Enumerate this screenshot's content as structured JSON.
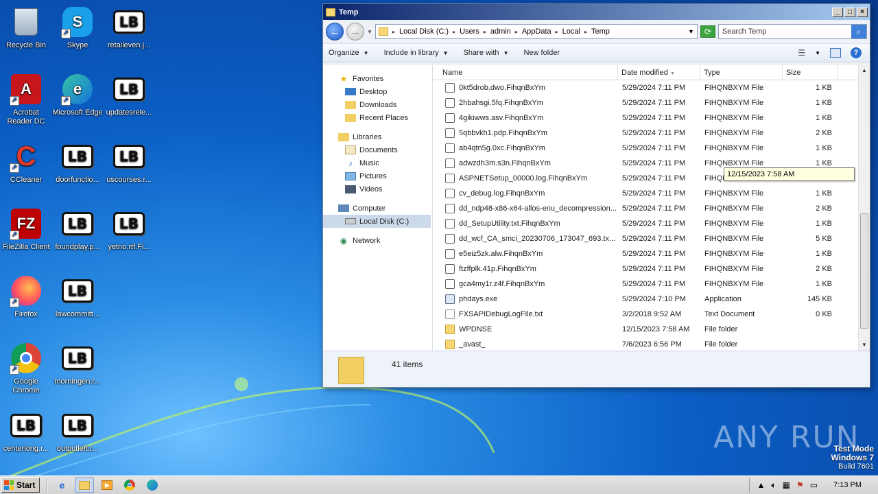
{
  "desktop": {
    "icons": [
      {
        "label": "Recycle Bin",
        "kind": "recycle-bin-icon",
        "shortcut": false
      },
      {
        "label": "Skype",
        "kind": "skype-icon",
        "shortcut": true
      },
      {
        "label": "retaileven.j...",
        "kind": "lb-file-icon",
        "shortcut": false
      },
      {
        "label": "Acrobat Reader DC",
        "kind": "acrobat-icon",
        "shortcut": true
      },
      {
        "label": "Microsoft Edge",
        "kind": "edge-icon",
        "shortcut": true
      },
      {
        "label": "updatesrele...",
        "kind": "lb-file-icon",
        "shortcut": false
      },
      {
        "label": "CCleaner",
        "kind": "ccleaner-icon",
        "shortcut": true
      },
      {
        "label": "doorfunctio...",
        "kind": "lb-file-icon",
        "shortcut": false
      },
      {
        "label": "uscourses.r...",
        "kind": "lb-file-icon",
        "shortcut": false
      },
      {
        "label": "FileZilla Client",
        "kind": "filezilla-icon",
        "shortcut": true
      },
      {
        "label": "foundplay.p...",
        "kind": "lb-file-icon",
        "shortcut": false
      },
      {
        "label": "yetno.rtf.Fi...",
        "kind": "lb-file-icon",
        "shortcut": false
      },
      {
        "label": "Firefox",
        "kind": "firefox-icon",
        "shortcut": true
      },
      {
        "label": "lawcommitt...",
        "kind": "lb-file-icon",
        "shortcut": false
      },
      {
        "label": "Google Chrome",
        "kind": "chrome-icon",
        "shortcut": true
      },
      {
        "label": "morningen.r...",
        "kind": "lb-file-icon",
        "shortcut": false
      },
      {
        "label": "centerlong.r...",
        "kind": "lb-file-icon",
        "shortcut": false
      },
      {
        "label": "outputleft.r...",
        "kind": "lb-file-icon",
        "shortcut": false
      }
    ]
  },
  "window": {
    "title": "Temp",
    "address": {
      "crumbs": [
        "Local Disk (C:)",
        "Users",
        "admin",
        "AppData",
        "Local",
        "Temp"
      ]
    },
    "search": {
      "placeholder": "Search Temp"
    },
    "toolbar": {
      "organize": "Organize",
      "include_in_library": "Include in library",
      "share_with": "Share with",
      "new_folder": "New folder"
    },
    "nav": {
      "favorites": "Favorites",
      "desktop": "Desktop",
      "downloads": "Downloads",
      "recent_places": "Recent Places",
      "libraries": "Libraries",
      "documents": "Documents",
      "music": "Music",
      "pictures": "Pictures",
      "videos": "Videos",
      "computer": "Computer",
      "local_disk": "Local Disk (C:)",
      "network": "Network"
    },
    "columns": {
      "name": "Name",
      "date": "Date modified",
      "type": "Type",
      "size": "Size"
    },
    "files": [
      {
        "name": "0kt5drob.dwo.FihqnBxYm",
        "date": "5/29/2024 7:11 PM",
        "type": "FIHQNBXYM File",
        "size": "1 KB",
        "icon": "generic"
      },
      {
        "name": "2hbahsgi.5fq.FihqnBxYm",
        "date": "5/29/2024 7:11 PM",
        "type": "FIHQNBXYM File",
        "size": "1 KB",
        "icon": "generic"
      },
      {
        "name": "4gikiwws.asv.FihqnBxYm",
        "date": "5/29/2024 7:11 PM",
        "type": "FIHQNBXYM File",
        "size": "1 KB",
        "icon": "generic"
      },
      {
        "name": "5qbbvkh1.pdp.FihqnBxYm",
        "date": "5/29/2024 7:11 PM",
        "type": "FIHQNBXYM File",
        "size": "2 KB",
        "icon": "generic"
      },
      {
        "name": "ab4qtn5g.0xc.FihqnBxYm",
        "date": "5/29/2024 7:11 PM",
        "type": "FIHQNBXYM File",
        "size": "1 KB",
        "icon": "generic"
      },
      {
        "name": "adwzdh3m.s3n.FihqnBxYm",
        "date": "5/29/2024 7:11 PM",
        "type": "FIHQNBXYM File",
        "size": "1 KB",
        "icon": "generic"
      },
      {
        "name": "ASPNETSetup_00000.log.FihqnBxYm",
        "date": "5/29/2024 7:11 PM",
        "type": "FIHQNBXYM File",
        "size": "5 KB",
        "icon": "generic"
      },
      {
        "name": "cv_debug.log.FihqnBxYm",
        "date": "5/29/2024 7:11 PM",
        "type": "FIHQNBXYM File",
        "size": "1 KB",
        "icon": "generic"
      },
      {
        "name": "dd_ndp48-x86-x64-allos-enu_decompression...",
        "date": "5/29/2024 7:11 PM",
        "type": "FIHQNBXYM File",
        "size": "2 KB",
        "icon": "generic"
      },
      {
        "name": "dd_SetupUtility.txt.FihqnBxYm",
        "date": "5/29/2024 7:11 PM",
        "type": "FIHQNBXYM File",
        "size": "1 KB",
        "icon": "generic"
      },
      {
        "name": "dd_wcf_CA_smci_20230706_173047_693.tx...",
        "date": "5/29/2024 7:11 PM",
        "type": "FIHQNBXYM File",
        "size": "5 KB",
        "icon": "generic"
      },
      {
        "name": "e5eiz5zk.alw.FihqnBxYm",
        "date": "5/29/2024 7:11 PM",
        "type": "FIHQNBXYM File",
        "size": "1 KB",
        "icon": "generic"
      },
      {
        "name": "ftzffplk.41p.FihqnBxYm",
        "date": "5/29/2024 7:11 PM",
        "type": "FIHQNBXYM File",
        "size": "2 KB",
        "icon": "generic"
      },
      {
        "name": "gca4my1r.z4f.FihqnBxYm",
        "date": "5/29/2024 7:11 PM",
        "type": "FIHQNBXYM File",
        "size": "1 KB",
        "icon": "generic"
      },
      {
        "name": "phdays.exe",
        "date": "5/29/2024 7:10 PM",
        "type": "Application",
        "size": "145 KB",
        "icon": "exe"
      },
      {
        "name": "FXSAPIDebugLogFile.txt",
        "date": "3/2/2018 9:52 AM",
        "type": "Text Document",
        "size": "0 KB",
        "icon": "txt"
      },
      {
        "name": "WPDNSE",
        "date": "12/15/2023 7:58 AM",
        "type": "File folder",
        "size": "",
        "icon": "folder"
      },
      {
        "name": "_avast_",
        "date": "7/6/2023 6:56 PM",
        "type": "File folder",
        "size": "",
        "icon": "folder"
      }
    ],
    "tooltip": "12/15/2023 7:58 AM",
    "item_count": "41 items"
  },
  "watermark": {
    "brand": "ANY RUN",
    "mode": "Test Mode",
    "os": "Windows 7",
    "build": "Build 7601"
  },
  "taskbar": {
    "start": "Start",
    "clock": "7:13 PM"
  }
}
